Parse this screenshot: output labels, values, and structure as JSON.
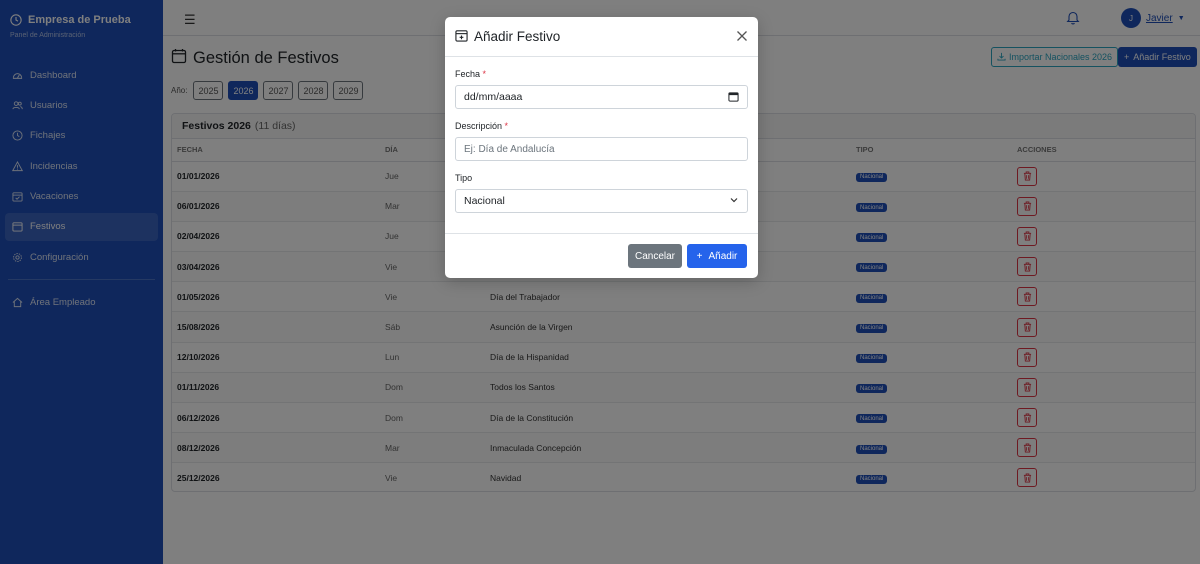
{
  "brand": {
    "title": "Empresa de Prueba",
    "subtitle": "Panel de Administración"
  },
  "sidebar": {
    "items": [
      {
        "label": "Dashboard",
        "icon": "gauge-icon"
      },
      {
        "label": "Usuarios",
        "icon": "users-icon"
      },
      {
        "label": "Fichajes",
        "icon": "clock-icon"
      },
      {
        "label": "Incidencias",
        "icon": "warning-icon"
      },
      {
        "label": "Vacaciones",
        "icon": "calendar-check-icon"
      },
      {
        "label": "Festivos",
        "icon": "calendar-icon",
        "active": true
      },
      {
        "label": "Configuración",
        "icon": "gear-icon"
      }
    ],
    "employee_area": "Área Empleado"
  },
  "topbar": {
    "user_initial": "J",
    "user_name": "Javier"
  },
  "page": {
    "title": "Gestión de Festivos",
    "import_label": "Importar Nacionales 2026",
    "add_label": "Añadir Festivo",
    "year_label": "Año:",
    "years": [
      "2025",
      "2026",
      "2027",
      "2028",
      "2029"
    ],
    "active_year": "2026"
  },
  "table": {
    "title": "Festivos 2026",
    "count": "(11 días)",
    "headers": {
      "fecha": "FECHA",
      "dia": "DÍA",
      "tipo": "TIPO",
      "acciones": "ACCIONES"
    },
    "rows": [
      {
        "fecha": "01/01/2026",
        "dia": "Jue",
        "nombre": "",
        "tipo": "Nacional"
      },
      {
        "fecha": "06/01/2026",
        "dia": "Mar",
        "nombre": "",
        "tipo": "Nacional"
      },
      {
        "fecha": "02/04/2026",
        "dia": "Jue",
        "nombre": "",
        "tipo": "Nacional"
      },
      {
        "fecha": "03/04/2026",
        "dia": "Vie",
        "nombre": "",
        "tipo": "Nacional"
      },
      {
        "fecha": "01/05/2026",
        "dia": "Vie",
        "nombre": "Día del Trabajador",
        "tipo": "Nacional"
      },
      {
        "fecha": "15/08/2026",
        "dia": "Sáb",
        "nombre": "Asunción de la Virgen",
        "tipo": "Nacional"
      },
      {
        "fecha": "12/10/2026",
        "dia": "Lun",
        "nombre": "Día de la Hispanidad",
        "tipo": "Nacional"
      },
      {
        "fecha": "01/11/2026",
        "dia": "Dom",
        "nombre": "Todos los Santos",
        "tipo": "Nacional"
      },
      {
        "fecha": "06/12/2026",
        "dia": "Dom",
        "nombre": "Día de la Constitución",
        "tipo": "Nacional"
      },
      {
        "fecha": "08/12/2026",
        "dia": "Mar",
        "nombre": "Inmaculada Concepción",
        "tipo": "Nacional"
      },
      {
        "fecha": "25/12/2026",
        "dia": "Vie",
        "nombre": "Navidad",
        "tipo": "Nacional"
      }
    ]
  },
  "modal": {
    "title": "Añadir Festivo",
    "fecha_label": "Fecha",
    "fecha_placeholder": "dd/mm/aaaa",
    "descripcion_label": "Descripción",
    "descripcion_placeholder": "Ej: Día de Andalucía",
    "tipo_label": "Tipo",
    "tipo_value": "Nacional",
    "required_mark": "*",
    "cancel_label": "Cancelar",
    "add_label": "Añadir"
  },
  "colors": {
    "primary": "#1f4fb8",
    "danger": "#dc3545",
    "info": "#2aa4c0",
    "add_button": "#2563eb"
  }
}
